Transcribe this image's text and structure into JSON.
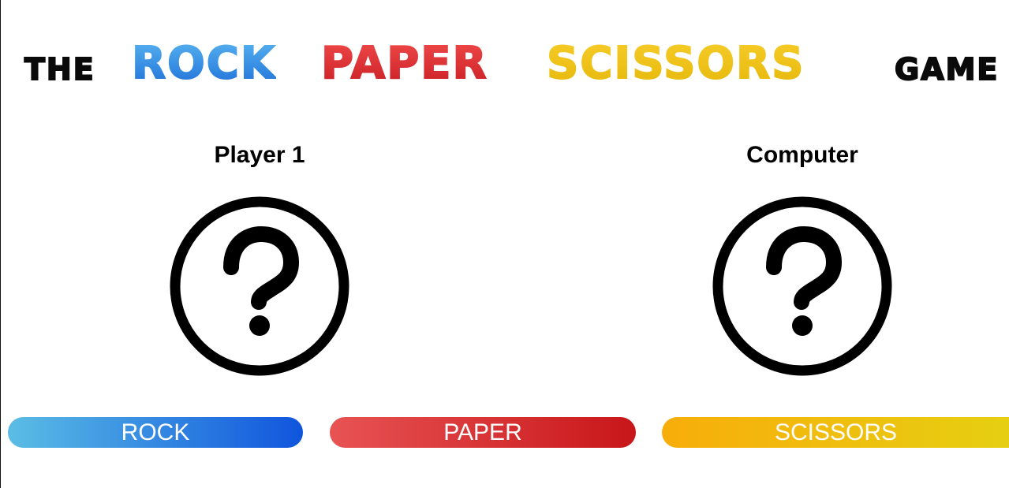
{
  "title": {
    "the": "THE",
    "rock": "ROCK",
    "paper": "PAPER",
    "scissors": "SCISSORS",
    "game": "GAME"
  },
  "players": {
    "player1": {
      "label": "Player 1",
      "choice_icon": "question-icon"
    },
    "computer": {
      "label": "Computer",
      "choice_icon": "question-icon"
    }
  },
  "choices": {
    "rock": "ROCK",
    "paper": "PAPER",
    "scissors": "SCISSORS"
  },
  "colors": {
    "rock": "#1e6fd8",
    "paper": "#c81e24",
    "scissors": "#eec11a"
  }
}
